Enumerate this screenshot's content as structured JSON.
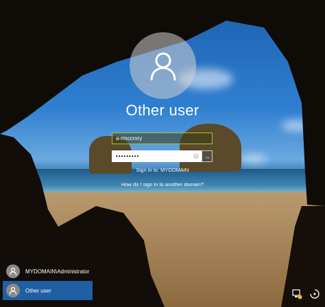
{
  "login": {
    "title": "Other user",
    "username_value": "a-rmccrory",
    "password_value": "•••••••••",
    "sign_in_to": "Sign in to: MYDOMAIN",
    "help_link": "How do I sign in to another domain?"
  },
  "user_list": [
    {
      "label": "MYDOMAIN\\Administrator",
      "selected": false
    },
    {
      "label": "Other user",
      "selected": true
    }
  ],
  "system_icons": [
    "network-icon",
    "ease-of-access-icon"
  ],
  "colors": {
    "selected_user_bg": "#1f5fa3",
    "username_field_border": "#a7c23a"
  }
}
